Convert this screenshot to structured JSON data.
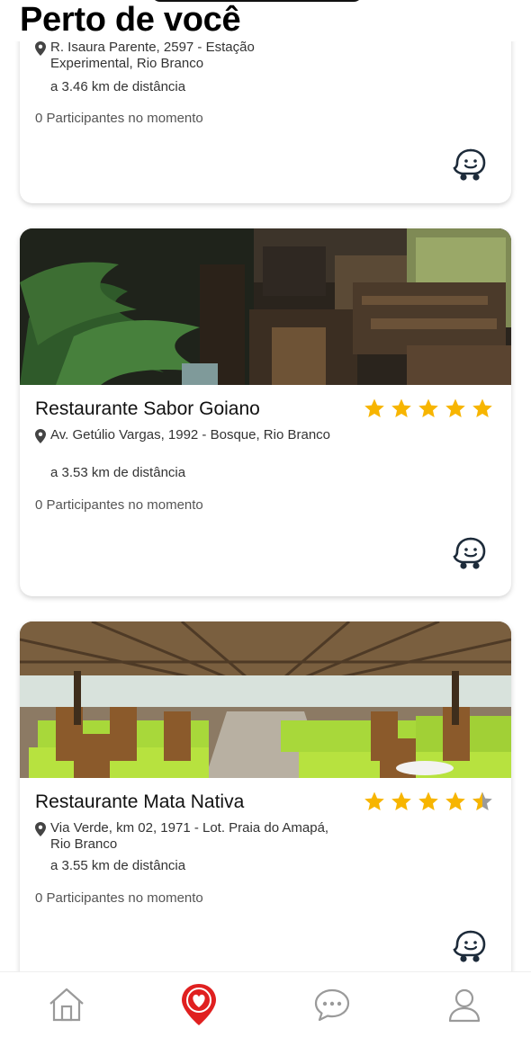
{
  "header": {
    "title": "Perto de você"
  },
  "restaurants": [
    {
      "name": "",
      "address": "R. Isaura Parente, 2597 - Estação Experimental, Rio Branco",
      "distance": "a 3.46 km de distância",
      "participants": "0 Participantes no momento",
      "rating": null
    },
    {
      "name": "Restaurante Sabor Goiano",
      "address": "Av. Getúlio Vargas, 1992 - Bosque, Rio Branco",
      "distance": "a 3.53 km de distância",
      "participants": "0 Participantes no momento",
      "rating": 5
    },
    {
      "name": "Restaurante Mata Nativa",
      "address": "Via Verde, km 02, 1971 - Lot. Praia do Amapá, Rio Branco",
      "distance": "a 3.55 km de distância",
      "participants": "0 Participantes no momento",
      "rating": 4.5
    }
  ],
  "icons": {
    "location": "map-pin-icon",
    "navigation": "waze-icon",
    "rating": "star-icon"
  },
  "tabs": [
    {
      "id": "home",
      "icon": "home-icon",
      "active": false
    },
    {
      "id": "nearby",
      "icon": "location-heart-icon",
      "active": true
    },
    {
      "id": "chat",
      "icon": "chat-bubble-icon",
      "active": false
    },
    {
      "id": "profile",
      "icon": "user-icon",
      "active": false
    }
  ],
  "colors": {
    "accent": "#e02020",
    "star": "#f7b500",
    "icon_gray": "#9a9a9a"
  }
}
